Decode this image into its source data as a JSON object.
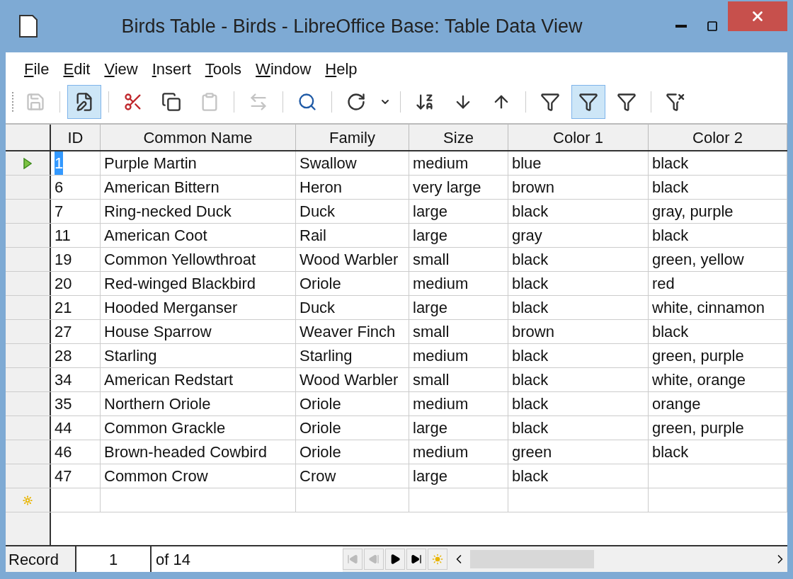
{
  "window": {
    "title": "Birds Table - Birds - LibreOffice Base: Table Data View"
  },
  "menu": [
    "File",
    "Edit",
    "View",
    "Insert",
    "Tools",
    "Window",
    "Help"
  ],
  "toolbar": [
    {
      "kind": "save",
      "pressed": false,
      "disabled": true
    },
    {
      "kind": "separator"
    },
    {
      "kind": "edit",
      "pressed": true,
      "disabled": false
    },
    {
      "kind": "separator"
    },
    {
      "kind": "cut",
      "pressed": false,
      "disabled": false
    },
    {
      "kind": "copy",
      "pressed": false,
      "disabled": false
    },
    {
      "kind": "paste",
      "pressed": false,
      "disabled": true
    },
    {
      "kind": "separator"
    },
    {
      "kind": "undo",
      "pressed": false,
      "disabled": true
    },
    {
      "kind": "separator"
    },
    {
      "kind": "find",
      "pressed": false,
      "disabled": false
    },
    {
      "kind": "separator"
    },
    {
      "kind": "refresh",
      "pressed": false,
      "disabled": false
    },
    {
      "kind": "dropdown",
      "pressed": false,
      "disabled": false
    },
    {
      "kind": "separator"
    },
    {
      "kind": "sort",
      "pressed": false,
      "disabled": false
    },
    {
      "kind": "sort-ascending",
      "pressed": false,
      "disabled": false
    },
    {
      "kind": "sort-descending",
      "pressed": false,
      "disabled": false
    },
    {
      "kind": "separator"
    },
    {
      "kind": "filter",
      "pressed": false,
      "disabled": false
    },
    {
      "kind": "auto-filter",
      "pressed": true,
      "disabled": false
    },
    {
      "kind": "standard-filter",
      "pressed": false,
      "disabled": false
    },
    {
      "kind": "separator"
    },
    {
      "kind": "remove-filter",
      "pressed": false,
      "disabled": false
    }
  ],
  "table": {
    "columns": [
      "ID",
      "Common Name",
      "Family",
      "Size",
      "Color 1",
      "Color 2"
    ],
    "rows": [
      {
        "current": true,
        "cells": [
          "1",
          "Purple Martin",
          "Swallow",
          "medium",
          "blue",
          "black"
        ]
      },
      {
        "current": false,
        "cells": [
          "6",
          "American Bittern",
          "Heron",
          "very large",
          "brown",
          "black"
        ]
      },
      {
        "current": false,
        "cells": [
          "7",
          "Ring-necked Duck",
          "Duck",
          "large",
          "black",
          "gray, purple"
        ]
      },
      {
        "current": false,
        "cells": [
          "11",
          "American Coot",
          "Rail",
          "large",
          "gray",
          "black"
        ]
      },
      {
        "current": false,
        "cells": [
          "19",
          "Common Yellowthroat",
          "Wood Warbler",
          "small",
          "black",
          "green, yellow"
        ]
      },
      {
        "current": false,
        "cells": [
          "20",
          "Red-winged Blackbird",
          "Oriole",
          "medium",
          "black",
          "red"
        ]
      },
      {
        "current": false,
        "cells": [
          "21",
          "Hooded Merganser",
          "Duck",
          "large",
          "black",
          "white, cinnamon"
        ]
      },
      {
        "current": false,
        "cells": [
          "27",
          "House Sparrow",
          "Weaver Finch",
          "small",
          "brown",
          "black"
        ]
      },
      {
        "current": false,
        "cells": [
          "28",
          "Starling",
          "Starling",
          "medium",
          "black",
          "green, purple"
        ]
      },
      {
        "current": false,
        "cells": [
          "34",
          "American Redstart",
          "Wood Warbler",
          "small",
          "black",
          "white, orange"
        ]
      },
      {
        "current": false,
        "cells": [
          "35",
          "Northern Oriole",
          "Oriole",
          "medium",
          "black",
          "orange"
        ]
      },
      {
        "current": false,
        "cells": [
          "44",
          "Common Grackle",
          "Oriole",
          "large",
          "black",
          "green, purple"
        ]
      },
      {
        "current": false,
        "cells": [
          "46",
          "Brown-headed Cowbird",
          "Oriole",
          "medium",
          "green",
          "black"
        ]
      },
      {
        "current": false,
        "cells": [
          "47",
          "Common Crow",
          "Crow",
          "large",
          "black",
          ""
        ]
      }
    ]
  },
  "record_bar": {
    "label": "Record",
    "value": "1",
    "total": "of 14",
    "nav": [
      {
        "kind": "first",
        "disabled": true
      },
      {
        "kind": "previous",
        "disabled": true
      },
      {
        "kind": "next",
        "disabled": false
      },
      {
        "kind": "last",
        "disabled": false
      },
      {
        "kind": "new",
        "disabled": false
      }
    ]
  }
}
